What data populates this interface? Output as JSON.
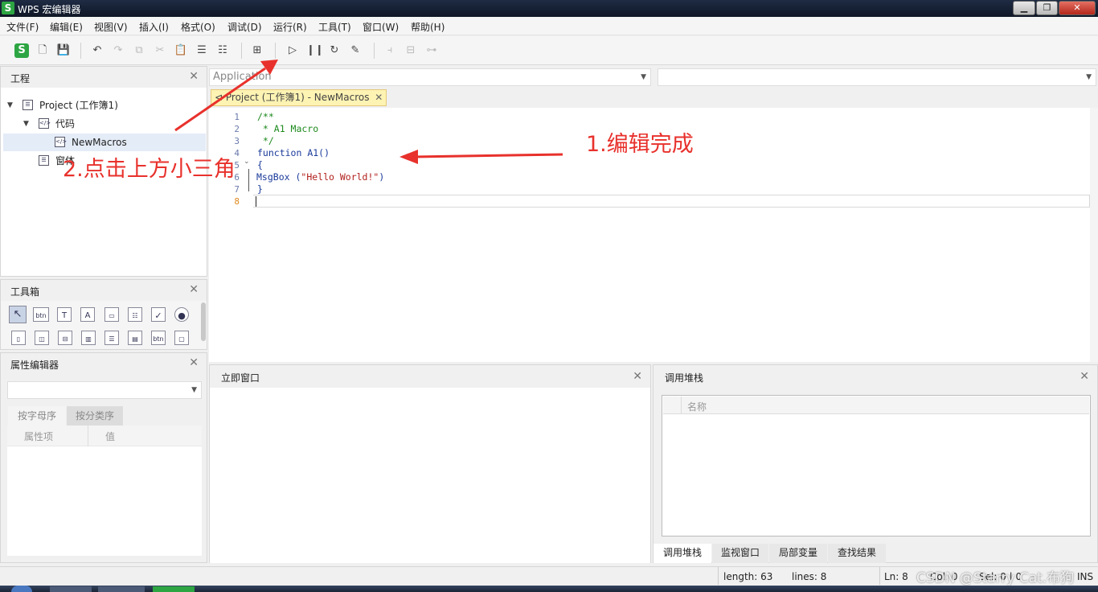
{
  "window": {
    "title": "WPS 宏编辑器",
    "logo": "S"
  },
  "menu": [
    "文件(F)",
    "编辑(E)",
    "视图(V)",
    "插入(I)",
    "格式(O)",
    "调试(D)",
    "运行(R)",
    "工具(T)",
    "窗口(W)",
    "帮助(H)"
  ],
  "project_panel": {
    "title": "工程",
    "tree": [
      {
        "label": "Project (工作簿1)"
      },
      {
        "label": "代码"
      },
      {
        "label": "NewMacros"
      },
      {
        "label": "窗体"
      }
    ]
  },
  "toolbox_panel": {
    "title": "工具箱"
  },
  "properties_panel": {
    "title": "属性编辑器",
    "tabs": [
      "按字母序",
      "按分类序"
    ],
    "columns": [
      "属性项",
      "值"
    ]
  },
  "editor": {
    "object_combo": "Application",
    "procedure_combo": "",
    "tab": "Project (工作簿1) - NewMacros",
    "line_numbers": [
      "1",
      "2",
      "3",
      "4",
      "5",
      "6",
      "7",
      "8"
    ],
    "code": {
      "l1": "/**",
      "l2": " * A1 Macro",
      "l3": " */",
      "l4_kw": "function ",
      "l4_id": "A1()",
      "l5": "{",
      "l6_id": "MsgBox (",
      "l6_str": "\"Hello World!\"",
      "l6_end": ")",
      "l7": "}"
    }
  },
  "immediate_panel": {
    "title": "立即窗口"
  },
  "callstack_panel": {
    "title": "调用堆栈",
    "column": "名称",
    "tabs": [
      "调用堆栈",
      "监视窗口",
      "局部变量",
      "查找结果"
    ]
  },
  "status": {
    "length": "length: 63",
    "lines": "lines: 8",
    "ln": "Ln: 8",
    "col": "Col: 0",
    "sel": "Sel: 0 | 0",
    "mode": "INS"
  },
  "annotations": {
    "step1": "1.编辑完成",
    "step2": "2.点击上方小三角",
    "watermark": "CSDN @Starry Cat.布狗"
  },
  "colors": {
    "annotation": "#e8312c",
    "comment": "#1d8a1d",
    "keyword": "#1a3a9a",
    "string": "#b0201c",
    "tab_highlight": "#fdf3b3"
  }
}
